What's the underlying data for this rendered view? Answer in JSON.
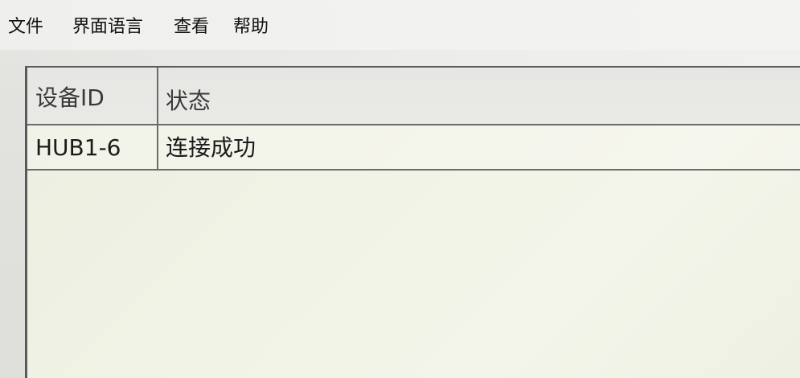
{
  "menubar": {
    "items": [
      "文件",
      "界面语言",
      "查看",
      "帮助"
    ]
  },
  "table": {
    "columns": [
      "设备ID",
      "状态"
    ],
    "rows": [
      [
        "HUB1-6",
        "连接成功"
      ]
    ]
  }
}
